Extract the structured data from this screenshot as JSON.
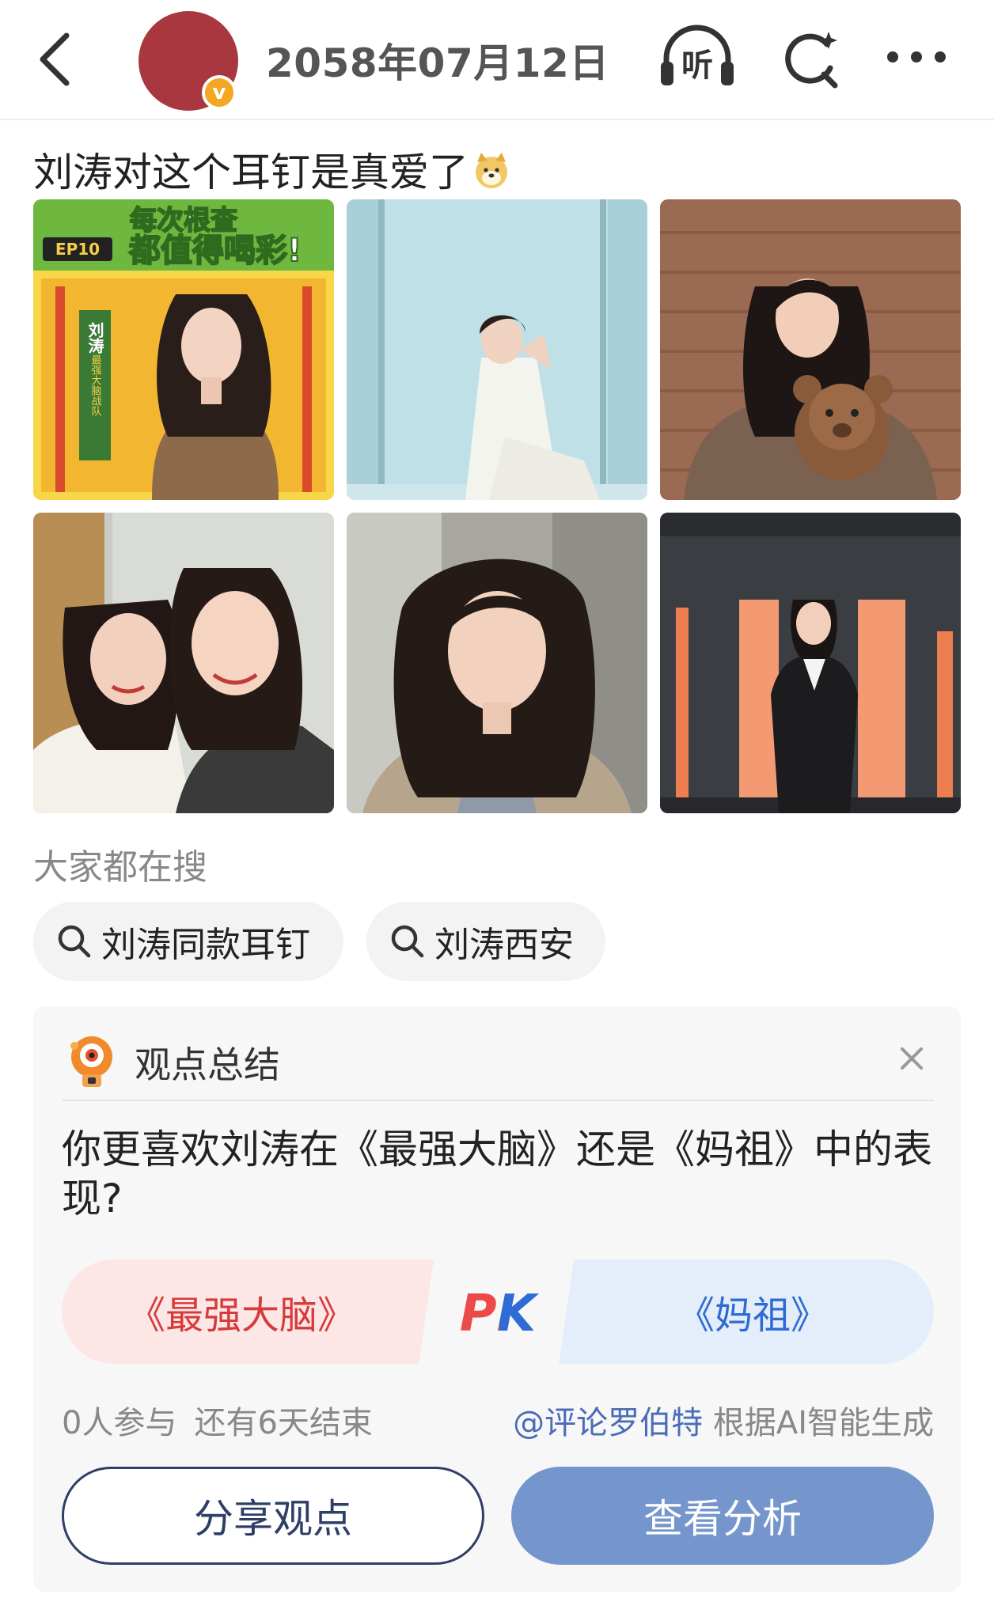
{
  "header": {
    "title": "2058年07月12日",
    "listen_label": "听",
    "icons": [
      "back-arrow-icon",
      "verified-badge-icon",
      "headphones-icon",
      "refresh-search-icon",
      "more-dots-icon"
    ],
    "avatar_color": "#a8373f",
    "badge_color": "#f5a623",
    "badge_glyph": "v"
  },
  "post": {
    "text": "刘涛对这个耳钉是真爱了",
    "emoji": "doge-icon"
  },
  "photos": {
    "p1": {
      "banner_line1": "每次根查",
      "banner_line2": "都值得喝彩!",
      "badge": "EP10",
      "side_name": "刘涛",
      "side_sub": "最强大脑战队"
    }
  },
  "search": {
    "heading": "大家都在搜",
    "chips": [
      "刘涛同款耳钉",
      "刘涛西安"
    ]
  },
  "opinion": {
    "title": "观点总结",
    "question": "你更喜欢刘涛在《最强大脑》还是《妈祖》中的表现?",
    "option_left": "《最强大脑》",
    "option_right": "《妈祖》",
    "pk_label": "PK",
    "participants": "0人参与",
    "remaining": "还有6天结束",
    "author": "@评论罗伯特",
    "generated_by": "根据AI智能生成",
    "share_button": "分享观点",
    "view_button": "查看分析",
    "colors": {
      "left_bg": "#fde6e6",
      "left_text": "#d63a3a",
      "right_bg": "#e4eefb",
      "right_text": "#2e6bd4",
      "primary_button": "#7496cc"
    }
  }
}
